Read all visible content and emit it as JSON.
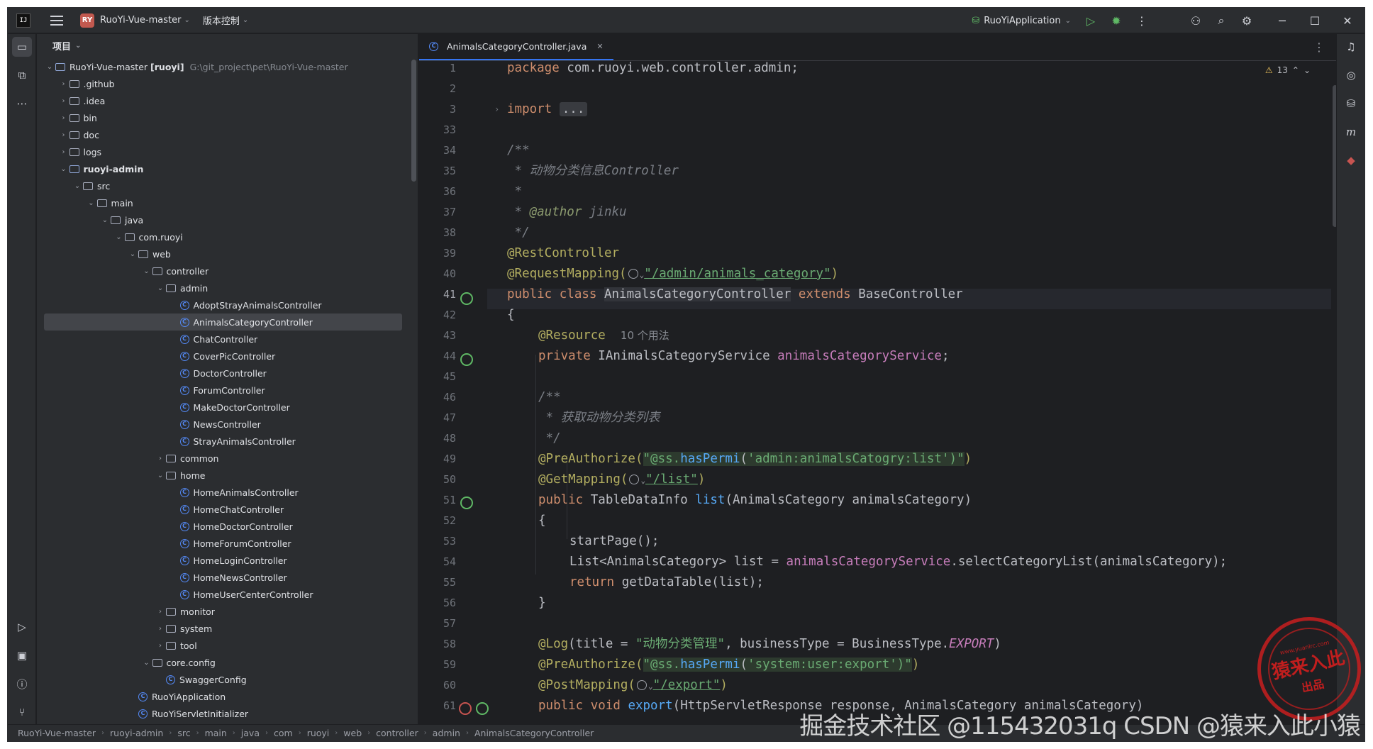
{
  "titlebar": {
    "project_badge": "RY",
    "project_name": "RuoYi-Vue-master",
    "vcs_label": "版本控制",
    "run_config": "RuoYiApplication"
  },
  "project_panel": {
    "title": "项目",
    "root_name": "RuoYi-Vue-master",
    "root_module": "[ruoyi]",
    "root_path": "G:\\git_project\\pet\\RuoYi-Vue-master",
    "items": [
      {
        "label": ".github",
        "type": "folder",
        "depth": 1,
        "expanded": false
      },
      {
        "label": ".idea",
        "type": "folder",
        "depth": 1,
        "expanded": false
      },
      {
        "label": "bin",
        "type": "folder",
        "depth": 1,
        "expanded": false
      },
      {
        "label": "doc",
        "type": "folder",
        "depth": 1,
        "expanded": false
      },
      {
        "label": "logs",
        "type": "folder",
        "depth": 1,
        "expanded": false
      },
      {
        "label": "ruoyi-admin",
        "type": "module",
        "depth": 1,
        "expanded": true
      },
      {
        "label": "src",
        "type": "folder",
        "depth": 2,
        "expanded": true
      },
      {
        "label": "main",
        "type": "folder",
        "depth": 3,
        "expanded": true
      },
      {
        "label": "java",
        "type": "folder",
        "depth": 4,
        "expanded": true
      },
      {
        "label": "com.ruoyi",
        "type": "package",
        "depth": 5,
        "expanded": true
      },
      {
        "label": "web",
        "type": "package",
        "depth": 6,
        "expanded": true
      },
      {
        "label": "controller",
        "type": "package",
        "depth": 7,
        "expanded": true
      },
      {
        "label": "admin",
        "type": "package",
        "depth": 8,
        "expanded": true
      },
      {
        "label": "AdoptStrayAnimalsController",
        "type": "class",
        "depth": 9
      },
      {
        "label": "AnimalsCategoryController",
        "type": "class",
        "depth": 9,
        "selected": true
      },
      {
        "label": "ChatController",
        "type": "class",
        "depth": 9
      },
      {
        "label": "CoverPicController",
        "type": "class",
        "depth": 9
      },
      {
        "label": "DoctorController",
        "type": "class",
        "depth": 9
      },
      {
        "label": "ForumController",
        "type": "class",
        "depth": 9
      },
      {
        "label": "MakeDoctorController",
        "type": "class",
        "depth": 9
      },
      {
        "label": "NewsController",
        "type": "class",
        "depth": 9
      },
      {
        "label": "StrayAnimalsController",
        "type": "class",
        "depth": 9
      },
      {
        "label": "common",
        "type": "package",
        "depth": 8,
        "expanded": false
      },
      {
        "label": "home",
        "type": "package",
        "depth": 8,
        "expanded": true
      },
      {
        "label": "HomeAnimalsController",
        "type": "class",
        "depth": 9
      },
      {
        "label": "HomeChatController",
        "type": "class",
        "depth": 9
      },
      {
        "label": "HomeDoctorController",
        "type": "class",
        "depth": 9
      },
      {
        "label": "HomeForumController",
        "type": "class",
        "depth": 9
      },
      {
        "label": "HomeLoginController",
        "type": "class",
        "depth": 9
      },
      {
        "label": "HomeNewsController",
        "type": "class",
        "depth": 9
      },
      {
        "label": "HomeUserCenterController",
        "type": "class",
        "depth": 9
      },
      {
        "label": "monitor",
        "type": "package",
        "depth": 8,
        "expanded": false
      },
      {
        "label": "system",
        "type": "package",
        "depth": 8,
        "expanded": false
      },
      {
        "label": "tool",
        "type": "package",
        "depth": 8,
        "expanded": false
      },
      {
        "label": "core.config",
        "type": "package",
        "depth": 7,
        "expanded": true
      },
      {
        "label": "SwaggerConfig",
        "type": "class",
        "depth": 8
      },
      {
        "label": "RuoYiApplication",
        "type": "app",
        "depth": 6
      },
      {
        "label": "RuoYiServletInitializer",
        "type": "class",
        "depth": 6
      }
    ]
  },
  "editor": {
    "tab_label": "AnimalsCategoryController.java",
    "warnings_count": "13",
    "current_line": "41",
    "line_numbers": [
      "1",
      "2",
      "3",
      "33",
      "34",
      "35",
      "36",
      "37",
      "38",
      "39",
      "40",
      "41",
      "42",
      "43",
      "44",
      "45",
      "46",
      "47",
      "48",
      "49",
      "50",
      "51",
      "52",
      "53",
      "54",
      "55",
      "56",
      "57",
      "58",
      "59",
      "60",
      "61"
    ],
    "code": {
      "l1_kw": "package",
      "l1_rest": " com.ruoyi.web.controller.admin;",
      "l3_kw": "import",
      "l3_fold": "...",
      "l34": "/**",
      "l35_star": " * ",
      "l35_text": "动物分类信息Controller",
      "l36": " *",
      "l37_star": " * ",
      "l37_tag": "@author",
      "l37_val": " jinku",
      "l38": " */",
      "l39": "@RestController",
      "l40_an": "@RequestMapping(",
      "l40_str": "\"/admin/animals_category\"",
      "l40_end": ")",
      "l41_kw": "public class ",
      "l41_name": "AnimalsCategoryController",
      "l41_kw2": " extends ",
      "l41_base": "BaseController",
      "l42": "{",
      "l43_an": "@Resource",
      "l43_hint": "10 个用法",
      "l44_kw": "private ",
      "l44_type": "IAnimalsCategoryService ",
      "l44_fld": "animalsCategoryService",
      "l44_end": ";",
      "l46": "/**",
      "l47_star": " * ",
      "l47_text": "获取动物分类列表",
      "l48": " */",
      "l49_an": "@PreAuthorize(",
      "l49_s1": "\"@ss.",
      "l49_fn": "hasPermi",
      "l49_s2": "(",
      "l49_s3": "'admin:animalsCatogry:list'",
      "l49_s4": ")\"",
      "l49_end": ")",
      "l50_an": "@GetMapping(",
      "l50_str": "\"/list\"",
      "l50_end": ")",
      "l51_kw": "public ",
      "l51_type": "TableDataInfo ",
      "l51_fn": "list",
      "l51_rest": "(AnimalsCategory animalsCategory)",
      "l52": "{",
      "l53": "startPage();",
      "l54_a": "List<AnimalsCategory> list = ",
      "l54_fld": "animalsCategoryService",
      "l54_b": ".selectCategoryList(animalsCategory);",
      "l55_kw": "return ",
      "l55_rest": "getDataTable(list);",
      "l56": "}",
      "l58_an": "@Log",
      "l58_a": "(title = ",
      "l58_str": "\"动物分类管理\"",
      "l58_b": ", businessType = BusinessType.",
      "l58_enum": "EXPORT",
      "l58_c": ")",
      "l59_an": "@PreAuthorize(",
      "l59_s1": "\"@ss.",
      "l59_fn": "hasPermi",
      "l59_s2": "(",
      "l59_s3": "'system:user:export'",
      "l59_s4": ")\"",
      "l59_end": ")",
      "l60_an": "@PostMapping(",
      "l60_str": "\"/export\"",
      "l60_end": ")",
      "l61_kw": "public void ",
      "l61_fn": "export",
      "l61_rest": "(HttpServletResponse response, AnimalsCategory animalsCategory)"
    }
  },
  "statusbar": {
    "crumbs": [
      "RuoYi-Vue-master",
      "ruoyi-admin",
      "src",
      "main",
      "java",
      "com",
      "ruoyi",
      "web",
      "controller",
      "admin",
      "AnimalsCategoryController"
    ]
  },
  "watermark": "掘金技术社区 @115432031q CSDN @猿来入此小猿",
  "stamp": {
    "top": "www.yuanlrc.com",
    "main": "猿来入此",
    "sub": "出品"
  },
  "colors": {
    "accent": "#3574f0",
    "keyword": "#cf8e6d",
    "string": "#6aab73",
    "annotation": "#b3ae60",
    "field": "#c77dbb"
  }
}
